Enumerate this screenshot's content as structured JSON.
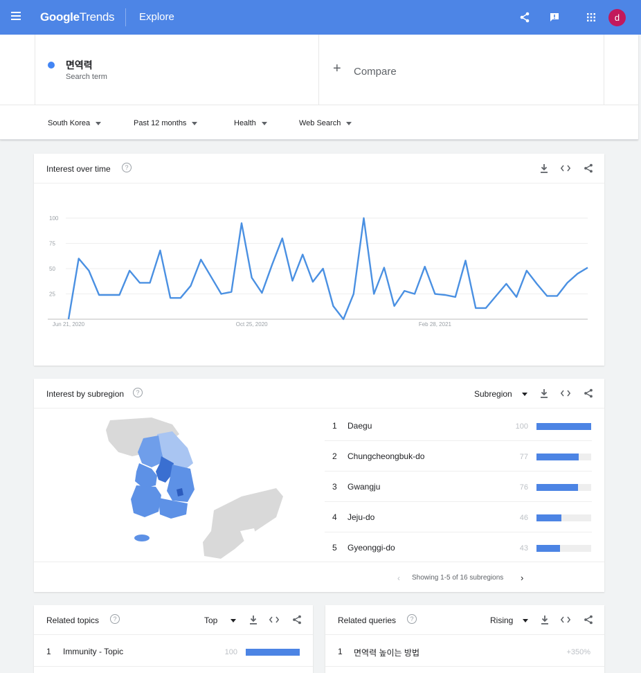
{
  "topbar": {
    "logo_google": "Google",
    "logo_trends": "Trends",
    "page": "Explore",
    "avatar_letter": "d"
  },
  "search": {
    "term": "면역력",
    "term_type": "Search term",
    "compare_label": "Compare"
  },
  "filters": {
    "region": "South Korea",
    "time": "Past 12 months",
    "category": "Health",
    "property": "Web Search"
  },
  "interest_over_time": {
    "title": "Interest over time"
  },
  "chart_data": {
    "type": "line",
    "title": "",
    "xlabel": "",
    "ylabel": "",
    "ylim": [
      0,
      100
    ],
    "yticks": [
      25,
      50,
      75,
      100
    ],
    "x_tick_labels": [
      "Jun 21, 2020",
      "Oct 25, 2020",
      "Feb 28, 2021"
    ],
    "x_tick_indices": [
      0,
      18,
      36
    ],
    "grid": true,
    "series": [
      {
        "color": "#4a90e2",
        "values": [
          0,
          60,
          48,
          24,
          24,
          24,
          48,
          36,
          36,
          68,
          21,
          21,
          33,
          59,
          42,
          25,
          27,
          95,
          41,
          26,
          54,
          80,
          38,
          64,
          37,
          50,
          13,
          0,
          25,
          100,
          25,
          51,
          13,
          28,
          25,
          52,
          25,
          24,
          22,
          58,
          11,
          11,
          23,
          35,
          22,
          48,
          35,
          23,
          23,
          36,
          45,
          51
        ]
      }
    ]
  },
  "subregion": {
    "title": "Interest by subregion",
    "view": "Subregion",
    "rows": [
      {
        "rank": "1",
        "name": "Daegu",
        "value": 100
      },
      {
        "rank": "2",
        "name": "Chungcheongbuk-do",
        "value": 77
      },
      {
        "rank": "3",
        "name": "Gwangju",
        "value": 76
      },
      {
        "rank": "4",
        "name": "Jeju-do",
        "value": 46
      },
      {
        "rank": "5",
        "name": "Gyeonggi-do",
        "value": 43
      }
    ],
    "pager_text": "Showing 1-5 of 16 subregions"
  },
  "related_topics": {
    "title": "Related topics",
    "view": "Top",
    "row": {
      "rank": "1",
      "name": "Immunity - Topic",
      "value": 100
    }
  },
  "related_queries": {
    "title": "Related queries",
    "view": "Rising",
    "row": {
      "rank": "1",
      "name": "면역력 높이는 방법",
      "value": "+350%"
    }
  }
}
